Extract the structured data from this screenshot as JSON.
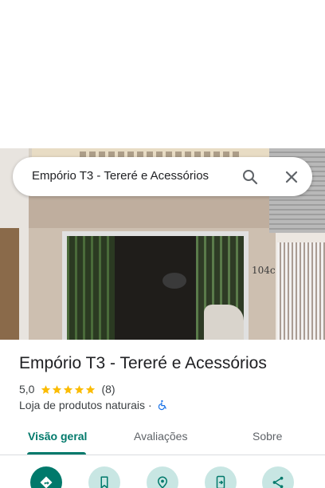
{
  "search": {
    "query": "Empório T3 - Tereré e Acessórios",
    "search_icon": "search-icon",
    "close_icon": "close-icon"
  },
  "photo": {
    "description_icon": "storefront-photo",
    "address_sign": "104c"
  },
  "place": {
    "name": "Empório T3 - Tereré e Acessórios",
    "rating": "5,0",
    "stars": 5,
    "review_count": "(8)",
    "category": "Loja de produtos naturais",
    "separator": "·",
    "accessibility_icon": "wheelchair-icon"
  },
  "tabs": [
    {
      "label": "Visão geral",
      "active": true
    },
    {
      "label": "Avaliações",
      "active": false
    },
    {
      "label": "Sobre",
      "active": false
    }
  ],
  "actions": [
    {
      "icon": "directions-icon",
      "primary": true
    },
    {
      "icon": "bookmark-icon",
      "primary": false
    },
    {
      "icon": "nearby-icon",
      "primary": false
    },
    {
      "icon": "send-to-phone-icon",
      "primary": false
    },
    {
      "icon": "share-icon",
      "primary": false
    }
  ],
  "colors": {
    "accent": "#00796b",
    "star": "#fbbc04",
    "text": "#202124",
    "muted": "#5f6368",
    "action_bg": "#c8e6e3",
    "accessibility": "#1a73e8"
  }
}
